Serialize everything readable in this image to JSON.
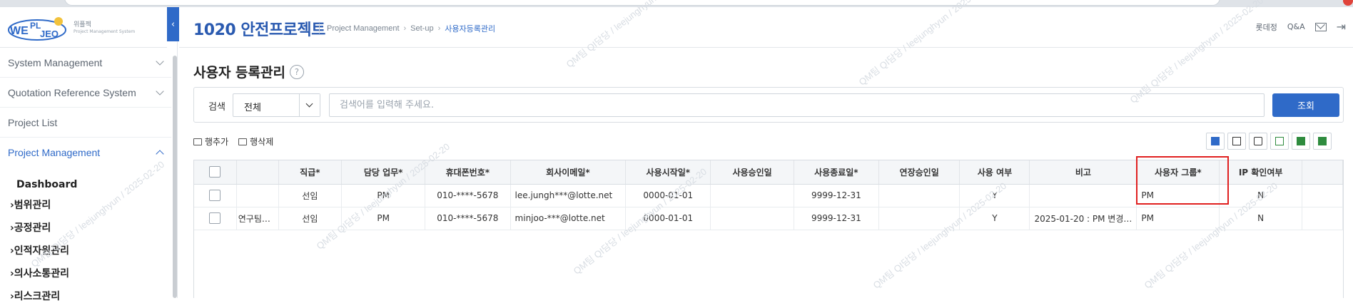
{
  "logo": {
    "text": "WE PLJEO",
    "name_kr": "위플젝",
    "name_en": "Project Management System"
  },
  "sidebar": {
    "collapse_glyph": "‹",
    "items": [
      {
        "label": "System Management",
        "expanded": false
      },
      {
        "label": "Quotation Reference System",
        "expanded": false
      },
      {
        "label": "Project List"
      },
      {
        "label": "Project Management",
        "expanded": true,
        "active": true
      }
    ],
    "submenu_head": "Dashboard",
    "submenu": [
      "›범위관리",
      "›공정관리",
      "›인적자원관리",
      "›의사소통관리",
      "›리스크관리"
    ]
  },
  "header": {
    "project_title": "1020 안전프로젝트",
    "breadcrumb": [
      "Project Management",
      "Set-up",
      "사용자등록관리"
    ],
    "user": "롯데정",
    "qa": "Q&A"
  },
  "page": {
    "title": "사용자 등록관리",
    "help": "?"
  },
  "search": {
    "label": "검색",
    "select_value": "전체",
    "placeholder": "검색어를 입력해 주세요.",
    "button": "조회"
  },
  "actions": {
    "add_row": "행추가",
    "delete_row": "행삭제"
  },
  "table": {
    "columns": [
      "",
      "",
      "직급*",
      "담당 업무*",
      "휴대폰번호*",
      "회사이메일*",
      "사용시작일*",
      "사용승인일",
      "사용종료일*",
      "연장승인일",
      "사용 여부",
      "비고",
      "사용자 그룹*",
      "IP 확인여부"
    ],
    "rows": [
      [
        "",
        "",
        "선임",
        "PM",
        "010-****-5678",
        "lee.jungh***@lotte.net",
        "0000-01-01",
        "",
        "9999-12-31",
        "",
        "Y",
        "",
        "PM",
        "N"
      ],
      [
        "",
        "연구팀…",
        "선임",
        "PM",
        "010-****-5678",
        "minjoo-***@lotte.net",
        "0000-01-01",
        "",
        "9999-12-31",
        "",
        "Y",
        "2025-01-20 : PM 변경…",
        "PM",
        "N"
      ]
    ]
  },
  "watermark": "QM팀 QI담당 / leejunghyun / 2025-02-20",
  "colors": {
    "accent": "#2f6ac8",
    "highlight": "#e02020"
  }
}
